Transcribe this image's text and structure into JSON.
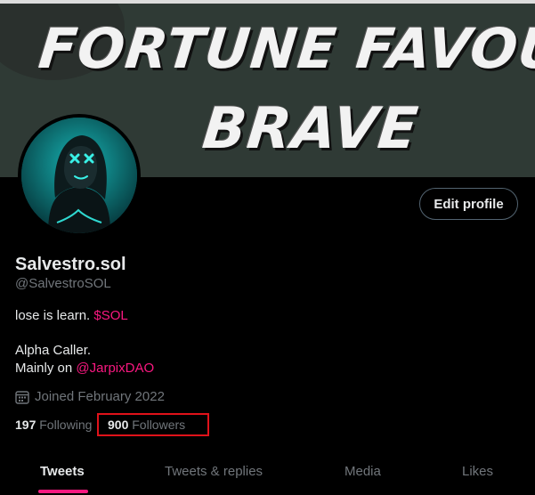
{
  "banner": {
    "line1": "FORTUNE FAVOURS THE",
    "line2": "BRAVE"
  },
  "profile": {
    "edit_label": "Edit profile",
    "name": "Salvestro.sol",
    "handle": "@SalvestroSOL",
    "bio_line1_text": "lose is learn. ",
    "bio_line1_tag": "$SOL",
    "bio_line2": "Alpha Caller.",
    "bio_line3_text": "Mainly on ",
    "bio_line3_mention": "@JarpixDAO",
    "joined": "Joined February 2022",
    "following_count": "197",
    "following_label": "Following",
    "followers_count": "900",
    "followers_label": "Followers"
  },
  "tabs": [
    {
      "label": "Tweets"
    },
    {
      "label": "Tweets & replies"
    },
    {
      "label": "Media"
    },
    {
      "label": "Likes"
    }
  ],
  "colors": {
    "accent": "#f91880",
    "highlight_box": "#e0121a",
    "background": "#000000"
  },
  "icons": {
    "calendar": "calendar-icon"
  }
}
